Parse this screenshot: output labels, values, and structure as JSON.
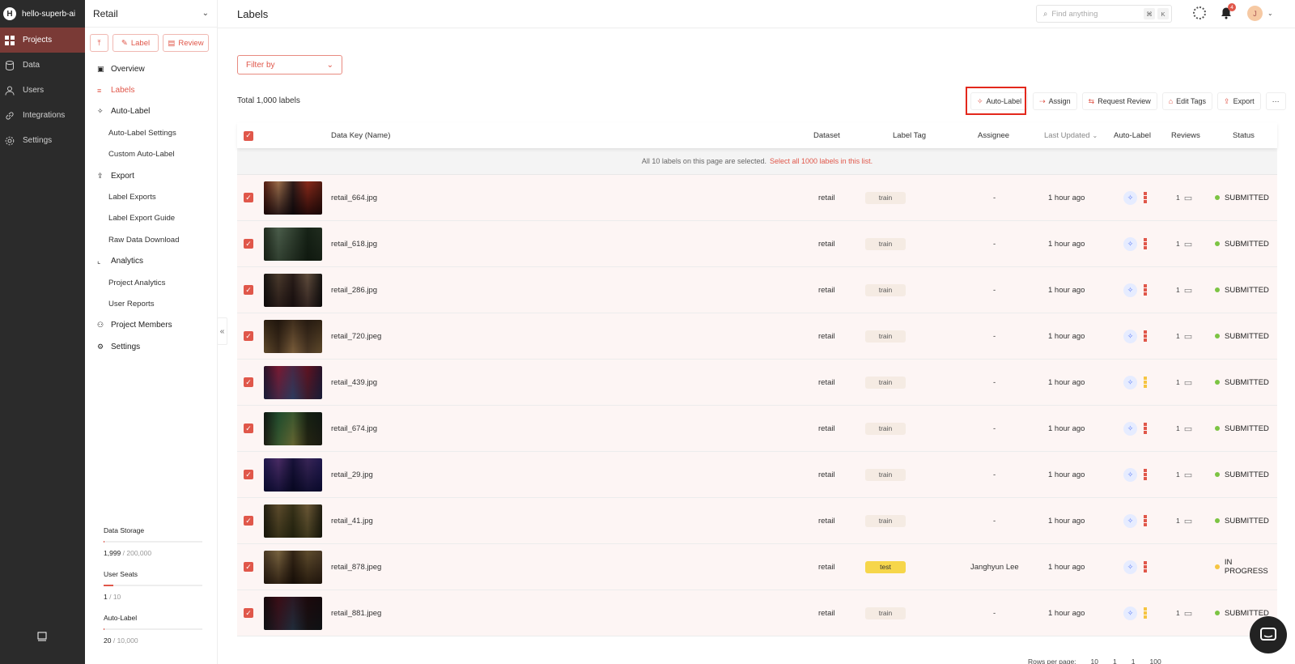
{
  "nav": {
    "workspace": "hello-superb-ai",
    "workspace_initial": "H",
    "items": [
      {
        "label": "Projects",
        "icon": "grid-icon",
        "active": true
      },
      {
        "label": "Data",
        "icon": "database-icon"
      },
      {
        "label": "Users",
        "icon": "user-icon"
      },
      {
        "label": "Integrations",
        "icon": "link-icon"
      },
      {
        "label": "Settings",
        "icon": "gear-icon"
      }
    ]
  },
  "project": {
    "name": "Retail",
    "actions": {
      "upload_icon": "upload-icon",
      "label": "Label",
      "review": "Review"
    },
    "menu": [
      {
        "label": "Overview",
        "type": "top"
      },
      {
        "label": "Labels",
        "type": "top",
        "active": true
      },
      {
        "label": "Auto-Label",
        "type": "top"
      },
      {
        "label": "Auto-Label Settings",
        "type": "sub"
      },
      {
        "label": "Custom Auto-Label",
        "type": "sub"
      },
      {
        "label": "Export",
        "type": "top"
      },
      {
        "label": "Label Exports",
        "type": "sub"
      },
      {
        "label": "Label Export Guide",
        "type": "sub"
      },
      {
        "label": "Raw Data Download",
        "type": "sub"
      },
      {
        "label": "Analytics",
        "type": "top"
      },
      {
        "label": "Project Analytics",
        "type": "sub"
      },
      {
        "label": "User Reports",
        "type": "sub"
      },
      {
        "label": "Project Members",
        "type": "top"
      },
      {
        "label": "Settings",
        "type": "top"
      }
    ],
    "stats": {
      "storage_label": "Data Storage",
      "storage_used": "1,999",
      "storage_total": "200,000",
      "storage_fraction": 0.01,
      "seats_label": "User Seats",
      "seats_used": "1",
      "seats_total": "10",
      "seats_fraction": 0.1,
      "autolabel_label": "Auto-Label",
      "autolabel_used": "20",
      "autolabel_total": "10,000",
      "autolabel_fraction": 0.002,
      "separator": " / "
    }
  },
  "topbar": {
    "title": "Labels",
    "search_placeholder": "Find anything",
    "kbd1": "⌘",
    "kbd2": "K",
    "notification_count": "4",
    "avatar_initial": "J"
  },
  "content": {
    "filter_label": "Filter by",
    "total": "Total 1,000 labels",
    "toolbar": [
      {
        "label": "Auto-Label",
        "icon": "✧"
      },
      {
        "label": "Assign",
        "icon": "⇢"
      },
      {
        "label": "Request Review",
        "icon": "⇆"
      },
      {
        "label": "Edit Tags",
        "icon": "⌂"
      },
      {
        "label": "Export",
        "icon": "⇪"
      },
      {
        "label": "···",
        "icon": ""
      }
    ],
    "columns": {
      "data_key": "Data Key (Name)",
      "dataset": "Dataset",
      "label_tag": "Label Tag",
      "assignee": "Assignee",
      "last_updated": "Last Updated",
      "auto_label": "Auto-Label",
      "reviews": "Reviews",
      "status": "Status"
    },
    "notice_text": "All 10 labels on this page are selected.",
    "notice_link": "Select all 1000 labels in this list."
  },
  "rows": [
    {
      "name": "retail_664.jpg",
      "dataset": "retail",
      "tag": "train",
      "assignee": "-",
      "updated": "1 hour ago",
      "bars": [
        "#e0574a",
        "#e0574a",
        "#e0574a"
      ],
      "reviews": "1",
      "status": "SUBMITTED",
      "status_color": "#7cc443",
      "thumb": [
        "#6b2a20",
        "#c7a88a",
        "#3a2a30",
        "#b04030"
      ]
    },
    {
      "name": "retail_618.jpg",
      "dataset": "retail",
      "tag": "train",
      "assignee": "-",
      "updated": "1 hour ago",
      "bars": [
        "#e0574a",
        "#e0574a",
        "#e0574a"
      ],
      "reviews": "1",
      "status": "SUBMITTED",
      "status_color": "#7cc443",
      "thumb": [
        "#3d4a3a",
        "#8a9a8a",
        "#5b6a5a",
        "#2a3a2a"
      ]
    },
    {
      "name": "retail_286.jpg",
      "dataset": "retail",
      "tag": "train",
      "assignee": "-",
      "updated": "1 hour ago",
      "bars": [
        "#e0574a",
        "#e0574a",
        "#e0574a"
      ],
      "reviews": "1",
      "status": "SUBMITTED",
      "status_color": "#7cc443",
      "thumb": [
        "#2a2a2a",
        "#8a7a6a",
        "#4a3a3a",
        "#b0a090"
      ]
    },
    {
      "name": "retail_720.jpeg",
      "dataset": "retail",
      "tag": "train",
      "assignee": "-",
      "updated": "1 hour ago",
      "bars": [
        "#e0574a",
        "#e0574a",
        "#e0574a"
      ],
      "reviews": "1",
      "status": "SUBMITTED",
      "status_color": "#7cc443",
      "thumb": [
        "#8a7a5a",
        "#5a4a3a",
        "#b09a7a",
        "#6a5a4a"
      ]
    },
    {
      "name": "retail_439.jpg",
      "dataset": "retail",
      "tag": "train",
      "assignee": "-",
      "updated": "1 hour ago",
      "bars": [
        "#f5c542",
        "#f5c542",
        "#f5c542"
      ],
      "reviews": "1",
      "status": "SUBMITTED",
      "status_color": "#7cc443",
      "thumb": [
        "#3a3a5a",
        "#b05070",
        "#6a7a9a",
        "#8a3a4a"
      ]
    },
    {
      "name": "retail_674.jpg",
      "dataset": "retail",
      "tag": "train",
      "assignee": "-",
      "updated": "1 hour ago",
      "bars": [
        "#e0574a",
        "#e0574a",
        "#e0574a"
      ],
      "reviews": "1",
      "status": "SUBMITTED",
      "status_color": "#7cc443",
      "thumb": [
        "#2a2a2a",
        "#5a8a6a",
        "#a0a070",
        "#3a3a2a"
      ]
    },
    {
      "name": "retail_29.jpg",
      "dataset": "retail",
      "tag": "train",
      "assignee": "-",
      "updated": "1 hour ago",
      "bars": [
        "#e0574a",
        "#e0574a",
        "#e0574a"
      ],
      "reviews": "1",
      "status": "SUBMITTED",
      "status_color": "#7cc443",
      "thumb": [
        "#3a3a7a",
        "#8a6aa0",
        "#2a2a5a",
        "#6a5a8a"
      ]
    },
    {
      "name": "retail_41.jpg",
      "dataset": "retail",
      "tag": "train",
      "assignee": "-",
      "updated": "1 hour ago",
      "bars": [
        "#e0574a",
        "#e0574a",
        "#e0574a"
      ],
      "reviews": "1",
      "status": "SUBMITTED",
      "status_color": "#7cc443",
      "thumb": [
        "#3a3a2a",
        "#9a8a6a",
        "#5a5a3a",
        "#b0a080"
      ]
    },
    {
      "name": "retail_878.jpeg",
      "dataset": "retail",
      "tag": "test",
      "assignee": "Janghyun Lee",
      "updated": "1 hour ago",
      "bars": [
        "#e0574a",
        "#e0574a",
        "#e0574a"
      ],
      "reviews": "",
      "status": "IN PROGRESS",
      "status_color": "#f5c542",
      "thumb": [
        "#6a5a4a",
        "#b0a080",
        "#4a3a2a",
        "#8a7a5a"
      ]
    },
    {
      "name": "retail_881.jpeg",
      "dataset": "retail",
      "tag": "train",
      "assignee": "-",
      "updated": "1 hour ago",
      "bars": [
        "#f5c542",
        "#f5c542",
        "#f5c542"
      ],
      "reviews": "1",
      "status": "SUBMITTED",
      "status_color": "#7cc443",
      "thumb": [
        "#2a2a2a",
        "#7a3a4a",
        "#5a6a7a",
        "#3a2a2a"
      ]
    }
  ],
  "pager": {
    "rows_per_page_label": "Rows per page:",
    "rows_per_page": "10",
    "page": "1",
    "current": "1",
    "total_pages": "100"
  },
  "colors": {
    "accent": "#e0574a",
    "nav_bg": "#2b2b2b",
    "active_nav": "#7a3a36",
    "highlight": "#e3281c"
  }
}
